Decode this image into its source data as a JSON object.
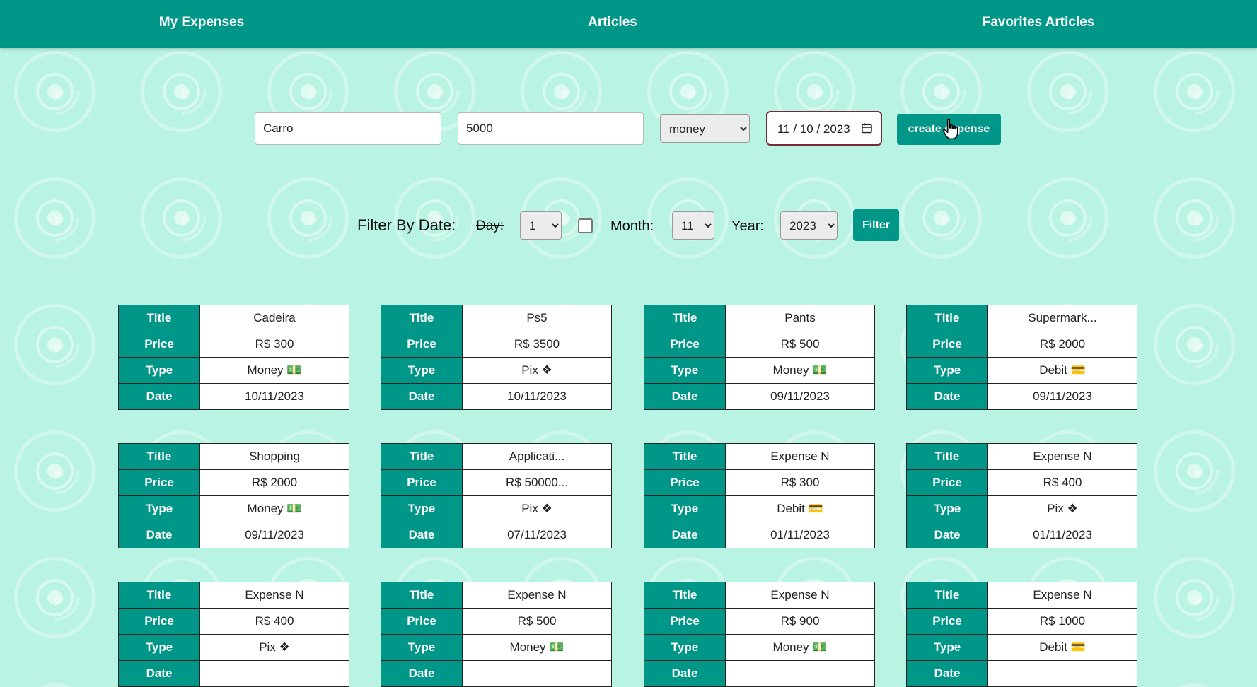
{
  "nav": {
    "my_expenses": "My Expenses",
    "articles": "Articles",
    "favorites": "Favorites Articles"
  },
  "create_form": {
    "title_value": "Carro",
    "price_value": "5000",
    "type_selected": "money",
    "date_value": "11 / 10 / 2023",
    "create_button": "create expense"
  },
  "filter": {
    "label": "Filter By Date:",
    "day_label": "Day:",
    "day_value": "1",
    "day_checked": false,
    "month_label": "Month:",
    "month_value": "11",
    "year_label": "Year:",
    "year_value": "2023",
    "button": "Filter"
  },
  "row_labels": {
    "title": "Title",
    "price": "Price",
    "type": "Type",
    "date": "Date"
  },
  "expenses": [
    {
      "title": "Cadeira",
      "price": "R$ 300",
      "type": "Money 💵",
      "date": "10/11/2023"
    },
    {
      "title": "Ps5",
      "price": "R$ 3500",
      "type": "Pix ❖",
      "date": "10/11/2023"
    },
    {
      "title": "Pants",
      "price": "R$ 500",
      "type": "Money 💵",
      "date": "09/11/2023"
    },
    {
      "title": "Supermark...",
      "price": "R$ 2000",
      "type": "Debit 💳",
      "date": "09/11/2023"
    },
    {
      "title": "Shopping",
      "price": "R$ 2000",
      "type": "Money 💵",
      "date": "09/11/2023"
    },
    {
      "title": "Applicati...",
      "price": "R$ 50000...",
      "type": "Pix ❖",
      "date": "07/11/2023"
    },
    {
      "title": "Expense N",
      "price": "R$ 300",
      "type": "Debit 💳",
      "date": "01/11/2023"
    },
    {
      "title": "Expense N",
      "price": "R$ 400",
      "type": "Pix ❖",
      "date": "01/11/2023"
    },
    {
      "title": "Expense N",
      "price": "R$ 400",
      "type": "Pix ❖",
      "date": ""
    },
    {
      "title": "Expense N",
      "price": "R$ 500",
      "type": "Money 💵",
      "date": ""
    },
    {
      "title": "Expense N",
      "price": "R$ 900",
      "type": "Money 💵",
      "date": ""
    },
    {
      "title": "Expense N",
      "price": "R$ 1000",
      "type": "Debit 💳",
      "date": ""
    }
  ],
  "colors": {
    "primary": "#009688",
    "background": "#b9f3e4",
    "date_border": "#7a2a3c"
  }
}
